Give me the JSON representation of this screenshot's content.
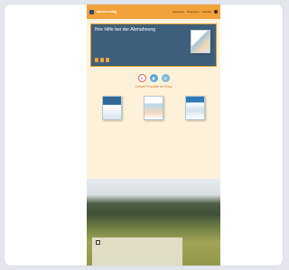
{
  "header": {
    "logo_text": "Musterverlag",
    "nav": [
      "Startseite",
      "Programm",
      "Kontakt"
    ]
  },
  "hero": {
    "title": "Ihre Hilfe bei der Abmahnung",
    "text": "",
    "buttons": []
  },
  "section": {
    "title": "Unsere Produkte im Shop"
  },
  "products": [
    {
      "name": "",
      "price": ""
    },
    {
      "name": "",
      "price": ""
    },
    {
      "name": "",
      "price": ""
    }
  ],
  "overlay": {
    "title": "",
    "text": ""
  },
  "colors": {
    "accent": "#f2a23a",
    "hero_bg": "#3e5f7c",
    "page_bg": "#fdf2d9",
    "price": "#2d8a4a"
  }
}
